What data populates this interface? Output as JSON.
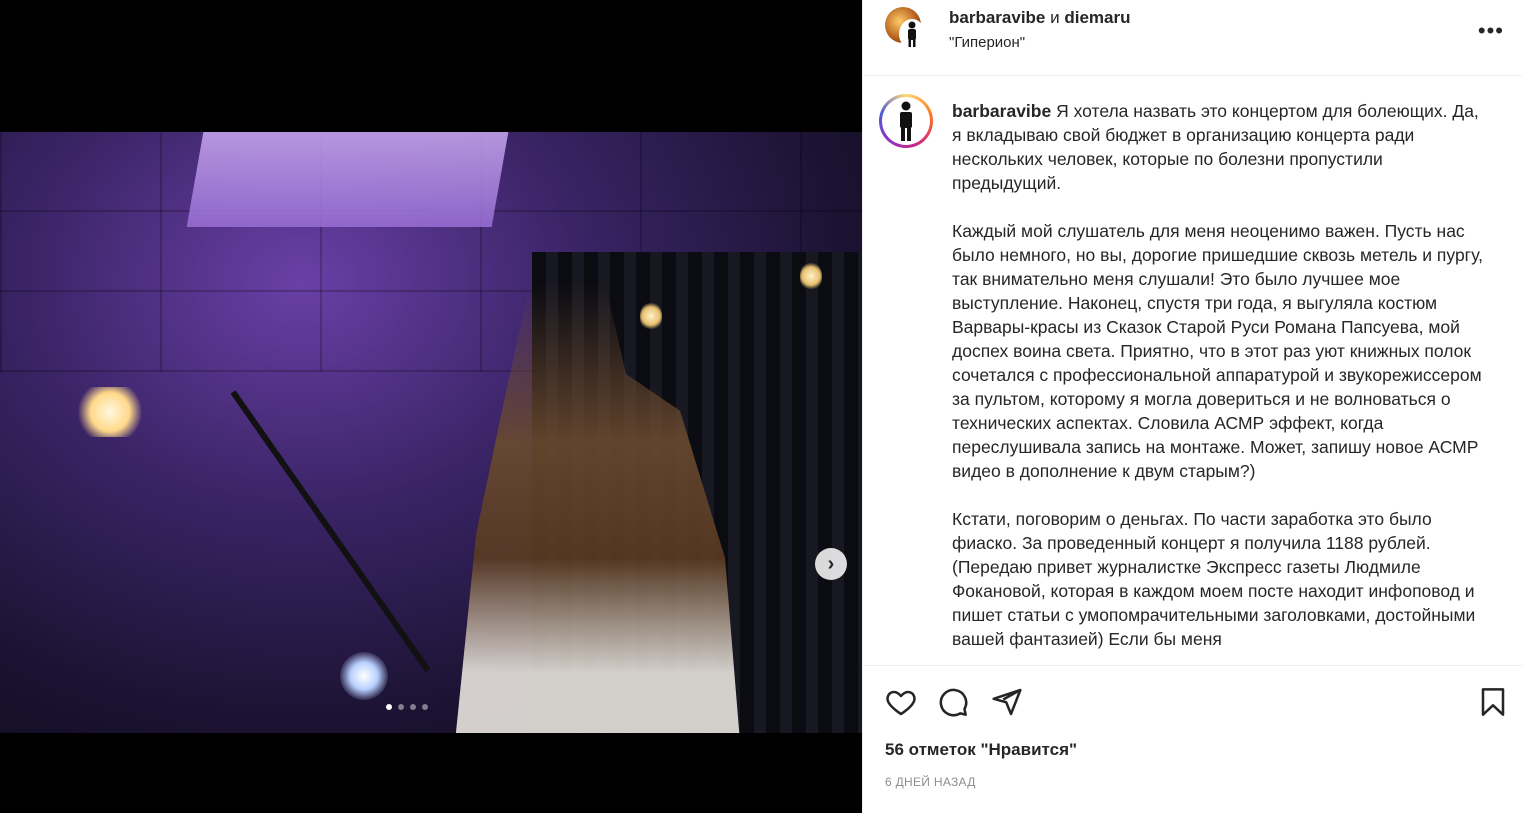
{
  "header": {
    "user1": "barbaravibe",
    "conjunction": "и",
    "user2": "diemaru",
    "location": "\"Гиперион\"",
    "more_icon": "more-horizontal-icon"
  },
  "post": {
    "author": "barbaravibe",
    "caption_p1": "Я хотела назвать это концертом для болеющих. Да, я вкладываю свой бюджет в организацию концерта ради нескольких человек, которые по болезни пропустили предыдущий.",
    "caption_p2": "Каждый мой слушатель для меня неоценимо важен. Пусть нас было немного, но вы, дорогие пришедшие сквозь метель и пургу, так внимательно меня слушали! Это было лучшее мое выступление. Наконец, спустя три года, я выгуляла костюм Варвары-красы из Сказок Старой Руси Романа Папсуева, мой доспех воина света. Приятно, что в этот раз уют книжных полок сочетался с профессиональной аппаратурой и звукорежиссером за пультом, которому я могла довериться и не волноваться о технических аспектах. Словила АСМР эффект, когда переслушивала запись на монтаже. Может, запишу новое АСМР видео в дополнение к двум старым?)",
    "caption_p3": "Кстати, поговорим о деньгах. По части заработка это было фиаско. За проведенный концерт я получила 1188 рублей. (Передаю привет журналистке Экспресс газеты Людмиле Фокановой, которая в каждом моем посте находит инфоповод и пишет статьи с умопомрачительными заголовками, достойными вашей фантазией) Если бы меня"
  },
  "media": {
    "slide_count": 4,
    "active_slide": 1,
    "next_icon": "chevron-right-icon"
  },
  "actions": {
    "like_icon": "heart-icon",
    "comment_icon": "comment-icon",
    "share_icon": "send-icon",
    "save_icon": "bookmark-icon"
  },
  "likes_text": "56 отметок \"Нравится\"",
  "date_text": "6 ДНЕЙ НАЗАД"
}
